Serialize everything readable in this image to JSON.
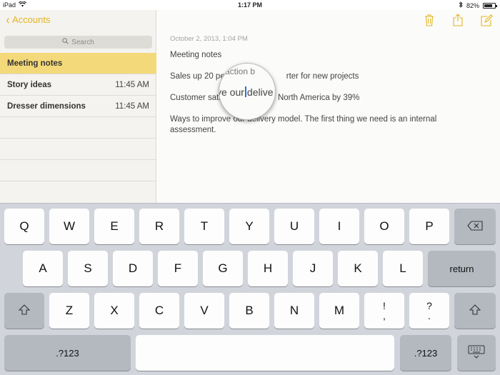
{
  "status": {
    "device": "iPad",
    "time": "1:17 PM",
    "battery": "82%",
    "battery_level": 0.82
  },
  "sidebar": {
    "back_label": "Accounts",
    "search_placeholder": "Search",
    "notes": [
      {
        "title": "Meeting notes",
        "time": "",
        "selected": true
      },
      {
        "title": "Story ideas",
        "time": "11:45 AM"
      },
      {
        "title": "Dresser dimensions",
        "time": "11:45 AM"
      }
    ]
  },
  "note": {
    "date": "October 2, 2013, 1:04 PM",
    "lines": [
      "Meeting notes",
      "Sales up 20 pe",
      "rter for new projects",
      "Customer sati",
      "North America by 39%",
      "Ways to improve our delivery model.  The first thing we need is an internal assessment."
    ],
    "magnifier_top": "action b",
    "magnifier_before": "ve our",
    "magnifier_after": "delive"
  },
  "keyboard": {
    "row1": [
      "Q",
      "W",
      "E",
      "R",
      "T",
      "Y",
      "U",
      "I",
      "O",
      "P"
    ],
    "row2": [
      "A",
      "S",
      "D",
      "F",
      "G",
      "H",
      "J",
      "K",
      "L"
    ],
    "return_label": "return",
    "row3": [
      "Z",
      "X",
      "C",
      "V",
      "B",
      "N",
      "M"
    ],
    "excl_top": "!",
    "excl_bottom": ",",
    "quest_top": "?",
    "quest_bottom": ".",
    "numbers_label": ".?123"
  },
  "colors": {
    "accent": "#e3b420",
    "selected_row": "#f4d97a",
    "keyboard_bg": "#d1d5db"
  }
}
